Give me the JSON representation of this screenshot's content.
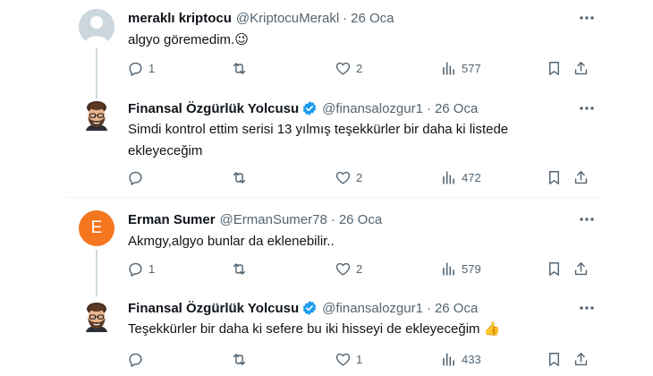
{
  "tweets": [
    {
      "name": "meraklı kriptocu",
      "handle": "@KriptocuMerakl",
      "dot": "·",
      "date": "26 Oca",
      "text": "algyo göremedim.😉",
      "reply_count": "1",
      "retweet_count": "",
      "like_count": "2",
      "view_count": "577",
      "avatar": "default-avatar",
      "verified": false
    },
    {
      "name": "Finansal Özgürlük Yolcusu",
      "handle": "@finansalozgur1",
      "dot": "·",
      "date": "26 Oca",
      "text": "Simdi kontrol ettim serisi 13 yılmış teşekkürler bir daha ki listede ekleyeceğim",
      "reply_count": "",
      "retweet_count": "",
      "like_count": "2",
      "view_count": "472",
      "avatar": "memoji-avatar",
      "verified": true
    },
    {
      "name": "Erman Sumer",
      "handle": "@ErmanSumer78",
      "dot": "·",
      "date": "26 Oca",
      "text": "Akmgy,algyo bunlar da eklenebilir..",
      "reply_count": "1",
      "retweet_count": "",
      "like_count": "2",
      "view_count": "579",
      "avatar_letter": "E",
      "verified": false
    },
    {
      "name": "Finansal Özgürlük Yolcusu",
      "handle": "@finansalozgur1",
      "dot": "·",
      "date": "26 Oca",
      "text": "Teşekkürler bir daha ki sefere bu iki hisseyi de ekleyeceğim 👍",
      "reply_count": "",
      "retweet_count": "",
      "like_count": "1",
      "view_count": "433",
      "avatar": "memoji-avatar",
      "verified": true
    }
  ],
  "colors": {
    "text": "#0f1419",
    "secondary": "#536471",
    "verified": "#1d9bf0",
    "thread_line": "#cfd9de",
    "divider": "#eff3f4",
    "avatar_letter_bg": "#f4761f"
  }
}
